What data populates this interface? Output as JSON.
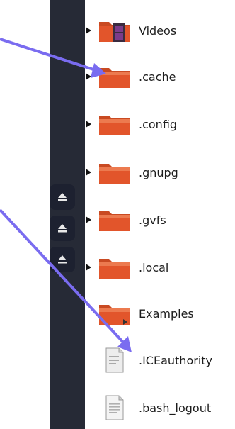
{
  "tree": {
    "items": [
      {
        "label": "Videos",
        "kind": "folder-videos",
        "expander": true
      },
      {
        "label": ".cache",
        "kind": "folder",
        "expander": true
      },
      {
        "label": ".config",
        "kind": "folder",
        "expander": true
      },
      {
        "label": ".gnupg",
        "kind": "folder",
        "expander": true
      },
      {
        "label": ".gvfs",
        "kind": "folder",
        "expander": true
      },
      {
        "label": ".local",
        "kind": "folder",
        "expander": true
      },
      {
        "label": "Examples",
        "kind": "folder-link",
        "expander": false
      },
      {
        "label": ".ICEauthority",
        "kind": "file",
        "expander": false
      },
      {
        "label": ".bash_logout",
        "kind": "file",
        "expander": false
      }
    ]
  },
  "sidebar": {
    "eject_icons": [
      "eject-icon",
      "eject-icon",
      "eject-icon"
    ]
  },
  "colors": {
    "sidebar_bg": "#262a36",
    "folder_orange": "#e2552b",
    "annotation_arrow": "#7a6cf0"
  }
}
